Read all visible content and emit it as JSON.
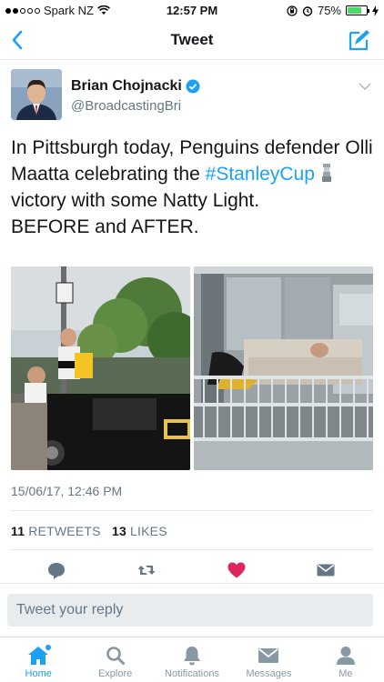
{
  "status_bar": {
    "carrier": "Spark NZ",
    "time": "12:57 PM",
    "battery_percent": "75%",
    "battery_level": 0.75
  },
  "nav": {
    "title": "Tweet",
    "back_icon": "chevron-left-icon",
    "compose_icon": "compose-icon"
  },
  "tweet": {
    "author_name": "Brian Chojnacki",
    "author_handle": "@BroadcastingBri",
    "text_part1": "In Pittsburgh today, Penguins defender Olli Maatta celebrating the ",
    "hashtag": "#StanleyCup",
    "text_part2": " victory with some Natty Light.",
    "text_line2": "BEFORE and AFTER.",
    "timestamp": "15/06/17, 12:46 PM",
    "retweets_count": "11",
    "retweets_label": "RETWEETS",
    "likes_count": "13",
    "likes_label": "LIKES"
  },
  "reply": {
    "placeholder": "Tweet your reply"
  },
  "tabs": [
    {
      "label": "Home",
      "icon": "home-icon",
      "active": true
    },
    {
      "label": "Explore",
      "icon": "search-icon",
      "active": false
    },
    {
      "label": "Notifications",
      "icon": "bell-icon",
      "active": false
    },
    {
      "label": "Messages",
      "icon": "envelope-icon",
      "active": false
    },
    {
      "label": "Me",
      "icon": "person-icon",
      "active": false
    }
  ],
  "colors": {
    "accent": "#1da1f2",
    "like": "#e0245e",
    "muted": "#657786"
  }
}
